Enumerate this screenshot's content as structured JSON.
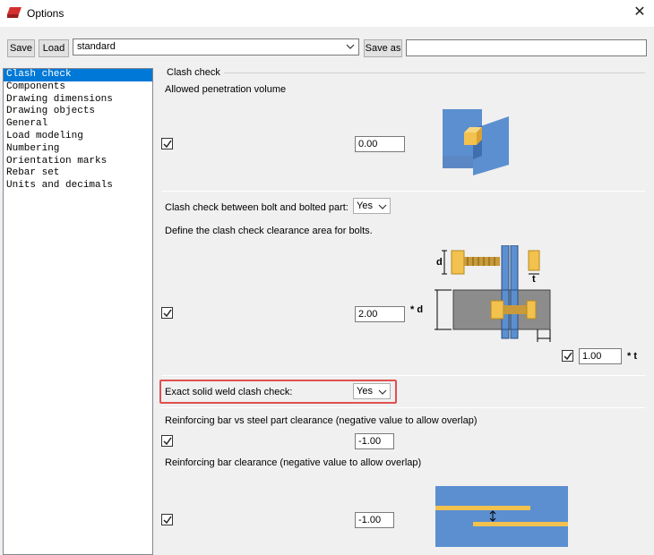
{
  "window": {
    "title": "Options",
    "close": "✕"
  },
  "toolbar": {
    "save_label": "Save",
    "load_label": "Load",
    "preset_value": "standard",
    "save_as_label": "Save as",
    "save_as_value": ""
  },
  "sidebar": {
    "items": [
      {
        "label": "Clash check",
        "selected": true
      },
      {
        "label": "Components"
      },
      {
        "label": "Drawing dimensions"
      },
      {
        "label": "Drawing objects"
      },
      {
        "label": "General"
      },
      {
        "label": "Load modeling"
      },
      {
        "label": "Numbering"
      },
      {
        "label": "Orientation marks"
      },
      {
        "label": "Rebar set"
      },
      {
        "label": "Units and decimals"
      }
    ]
  },
  "main": {
    "group_title": "Clash check",
    "penetration": {
      "label": "Allowed penetration volume",
      "checked": true,
      "value": "0.00"
    },
    "bolt": {
      "label": "Clash check between bolt and bolted part:",
      "select_value": "Yes",
      "clearance_label": "Define the clash check clearance area for bolts.",
      "checked": true,
      "d_value": "2.00",
      "d_suffix": "* d",
      "t_checked": true,
      "t_value": "1.00",
      "t_suffix": "* t",
      "diagram_d": "d",
      "diagram_t": "t"
    },
    "weld": {
      "label": "Exact solid weld clash check:",
      "select_value": "Yes"
    },
    "rebar_steel": {
      "label": "Reinforcing bar vs steel part clearance (negative value to allow overlap)",
      "checked": true,
      "value": "-1.00"
    },
    "rebar": {
      "label": "Reinforcing bar clearance (negative value to allow overlap)",
      "checked": true,
      "value": "-1.00"
    }
  },
  "colors": {
    "selection": "#0078d7",
    "diagram_blue": "#5b8fd0",
    "bolt_yellow": "#f2c14e",
    "highlight": "#e05050"
  }
}
